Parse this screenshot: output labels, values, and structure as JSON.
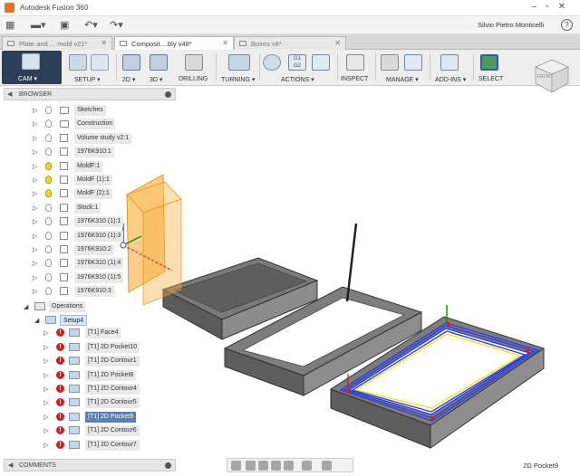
{
  "window": {
    "title": "Autodesk Fusion 360"
  },
  "user": {
    "name": "Silvio Pietro Monticelli",
    "help": "?"
  },
  "tabs": [
    {
      "label": "Plate and ... mold v21*",
      "active": false
    },
    {
      "label": "Composit....bly v48*",
      "active": true
    },
    {
      "label": "Boxes v8*",
      "active": false
    }
  ],
  "ribbon": {
    "workspace": "CAM",
    "groups": [
      {
        "label": "SETUP",
        "icon": "setup-icon"
      },
      {
        "label": "2D",
        "icon": "2d-icon"
      },
      {
        "label": "3D",
        "icon": "3d-icon"
      },
      {
        "label": "DRILLING",
        "icon": "drilling-icon"
      },
      {
        "label": "TURNING",
        "icon": "turning-icon"
      },
      {
        "label": "ACTIONS",
        "icon": "actions-icon"
      },
      {
        "label": "INSPECT",
        "icon": "inspect-icon"
      },
      {
        "label": "MANAGE",
        "icon": "manage-icon"
      },
      {
        "label": "ADD-INS",
        "icon": "addins-icon"
      },
      {
        "label": "SELECT",
        "icon": "select-icon"
      }
    ]
  },
  "viewcube": {
    "face": "FRONT"
  },
  "browser": {
    "header": "BROWSER",
    "items": [
      {
        "label": "Sketches",
        "kind": "folder",
        "light": false
      },
      {
        "label": "Construction",
        "kind": "folder",
        "light": false
      },
      {
        "label": "Volume study v2:1",
        "kind": "comp",
        "light": false
      },
      {
        "label": "1976K910:1",
        "kind": "comp",
        "light": false
      },
      {
        "label": "MoldF:1",
        "kind": "comp",
        "light": true
      },
      {
        "label": "MoldF (1):1",
        "kind": "comp",
        "light": true
      },
      {
        "label": "MoldF (2):1",
        "kind": "comp",
        "light": true
      },
      {
        "label": "Stock:1",
        "kind": "comp",
        "light": false
      },
      {
        "label": "1976K310 (1):1",
        "kind": "comp",
        "light": false
      },
      {
        "label": "1976K910 (1):3",
        "kind": "comp",
        "light": false
      },
      {
        "label": "1976K910:2",
        "kind": "comp",
        "light": false
      },
      {
        "label": "1976K310 (1):4",
        "kind": "comp",
        "light": false
      },
      {
        "label": "1976K910 (1):5",
        "kind": "comp",
        "light": false
      },
      {
        "label": "1976K910:3",
        "kind": "comp",
        "light": false
      }
    ],
    "operations_label": "Operations",
    "setup_label": "Setup4",
    "operations": [
      {
        "label": "[T1] Face4",
        "selected": false
      },
      {
        "label": "[T1] 2D Pocket10",
        "selected": false
      },
      {
        "label": "[T1] 2D Contour1",
        "selected": false
      },
      {
        "label": "[T1] 2D Pocket8",
        "selected": false
      },
      {
        "label": "[T1] 2D Contour4",
        "selected": false
      },
      {
        "label": "[T1] 2D Contour5",
        "selected": false
      },
      {
        "label": "[T1] 2D Pocket9",
        "selected": true
      },
      {
        "label": "[T1] 2D Contour6",
        "selected": false
      },
      {
        "label": "[T1] 2D Contour7",
        "selected": false
      }
    ]
  },
  "comments": {
    "label": "COMMENTS"
  },
  "status": {
    "selected_operation": "2D Pocket9"
  },
  "colors": {
    "cam_button": "#2c3f57",
    "selection": "#5a7fb0",
    "error": "#d31c1c",
    "toolpath": "#2f3fe0"
  }
}
